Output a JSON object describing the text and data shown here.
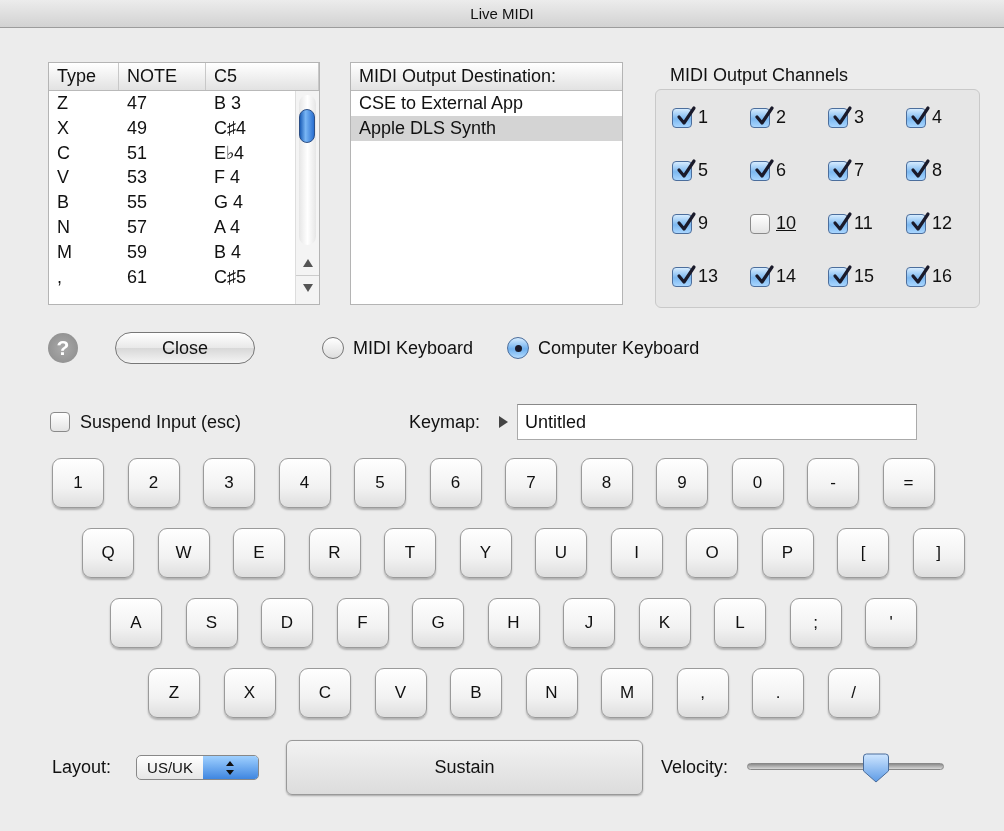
{
  "window": {
    "title": "Live MIDI"
  },
  "note_table": {
    "columns": [
      "Type",
      "NOTE",
      "C5"
    ],
    "rows": [
      {
        "key": "Z",
        "note": "47",
        "name": "B 3"
      },
      {
        "key": "X",
        "note": "49",
        "name": "C♯4"
      },
      {
        "key": "C",
        "note": "51",
        "name": "E♭4"
      },
      {
        "key": "V",
        "note": "53",
        "name": "F 4"
      },
      {
        "key": "B",
        "note": "55",
        "name": "G 4"
      },
      {
        "key": "N",
        "note": "57",
        "name": "A 4"
      },
      {
        "key": "M",
        "note": "59",
        "name": "B 4"
      },
      {
        "key": ",",
        "note": "61",
        "name": "C♯5"
      }
    ]
  },
  "destinations": {
    "header": "MIDI Output Destination:",
    "items": [
      {
        "label": "CSE to External App",
        "selected": false
      },
      {
        "label": "Apple DLS Synth",
        "selected": true
      }
    ]
  },
  "channels": {
    "title": "MIDI Output Channels",
    "items": [
      {
        "label": "1",
        "checked": true,
        "focused": false
      },
      {
        "label": "2",
        "checked": true,
        "focused": false
      },
      {
        "label": "3",
        "checked": true,
        "focused": false
      },
      {
        "label": "4",
        "checked": true,
        "focused": false
      },
      {
        "label": "5",
        "checked": true,
        "focused": false
      },
      {
        "label": "6",
        "checked": true,
        "focused": false
      },
      {
        "label": "7",
        "checked": true,
        "focused": false
      },
      {
        "label": "8",
        "checked": true,
        "focused": false
      },
      {
        "label": "9",
        "checked": true,
        "focused": false
      },
      {
        "label": "10",
        "checked": false,
        "focused": true
      },
      {
        "label": "11",
        "checked": true,
        "focused": false
      },
      {
        "label": "12",
        "checked": true,
        "focused": false
      },
      {
        "label": "13",
        "checked": true,
        "focused": false
      },
      {
        "label": "14",
        "checked": true,
        "focused": false
      },
      {
        "label": "15",
        "checked": true,
        "focused": false
      },
      {
        "label": "16",
        "checked": true,
        "focused": false
      }
    ]
  },
  "help_button": "?",
  "close_button": "Close",
  "input_modes": [
    {
      "label": "MIDI Keyboard",
      "selected": false
    },
    {
      "label": "Computer Keyboard",
      "selected": true
    }
  ],
  "suspend_input": {
    "label": "Suspend Input (esc)",
    "checked": false
  },
  "keymap": {
    "label": "Keymap:",
    "value": "Untitled"
  },
  "keyboard_rows": [
    [
      "1",
      "2",
      "3",
      "4",
      "5",
      "6",
      "7",
      "8",
      "9",
      "0",
      "-",
      "="
    ],
    [
      "Q",
      "W",
      "E",
      "R",
      "T",
      "Y",
      "U",
      "I",
      "O",
      "P",
      "[",
      "]"
    ],
    [
      "A",
      "S",
      "D",
      "F",
      "G",
      "H",
      "J",
      "K",
      "L",
      ";",
      "'"
    ],
    [
      "Z",
      "X",
      "C",
      "V",
      "B",
      "N",
      "M",
      ",",
      ".",
      "/"
    ]
  ],
  "layout": {
    "label": "Layout:",
    "value": "US/UK"
  },
  "sustain_button": "Sustain",
  "velocity": {
    "label": "Velocity:",
    "level": 0.68
  }
}
